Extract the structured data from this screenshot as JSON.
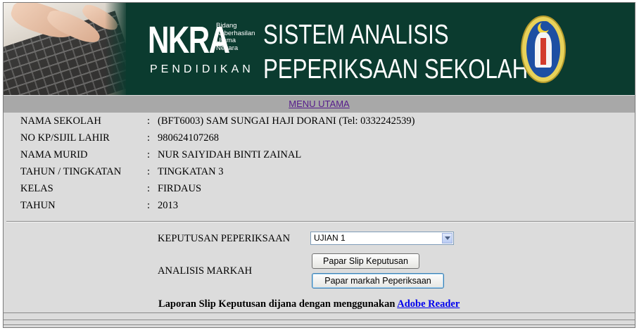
{
  "banner": {
    "logo_main": "NKRA",
    "logo_sub": [
      "Bidang",
      "Keberhasilan",
      "Utama",
      "Negara"
    ],
    "logo_pendidikan": "PENDIDIKAN",
    "title_line1": "SISTEM ANALISIS",
    "title_line2": "PEPERIKSAAN SEKOLAH"
  },
  "menu": {
    "link": "MENU UTAMA"
  },
  "info": {
    "colon": ":",
    "rows": [
      {
        "label": "NAMA SEKOLAH",
        "value": "(BFT6003) SAM SUNGAI HAJI DORANI (Tel: 0332242539)"
      },
      {
        "label": "NO KP/SIJIL LAHIR",
        "value": "980624107268"
      },
      {
        "label": "NAMA MURID",
        "value": "NUR SAIYIDAH BINTI ZAINAL"
      },
      {
        "label": "TAHUN / TINGKATAN",
        "value": "TINGKATAN 3"
      },
      {
        "label": "KELAS",
        "value": "FIRDAUS"
      },
      {
        "label": "TAHUN",
        "value": "2013"
      }
    ]
  },
  "form": {
    "exam_label": "KEPUTUSAN PEPERIKSAAN",
    "exam_selected": "UJIAN 1",
    "analysis_label": "ANALISIS MARKAH",
    "btn_slip": "Papar Slip Keputusan",
    "btn_markah": "Papar markah Peperiksaan"
  },
  "report": {
    "text": "Laporan Slip Keputusan dijana dengan menggunakan ",
    "link": "Adobe Reader"
  },
  "colors": {
    "banner_bg": "#0b3b2f",
    "page_bg": "#dcdcdc",
    "menu_bg": "#a8a8a8",
    "link": "#551a8b"
  }
}
